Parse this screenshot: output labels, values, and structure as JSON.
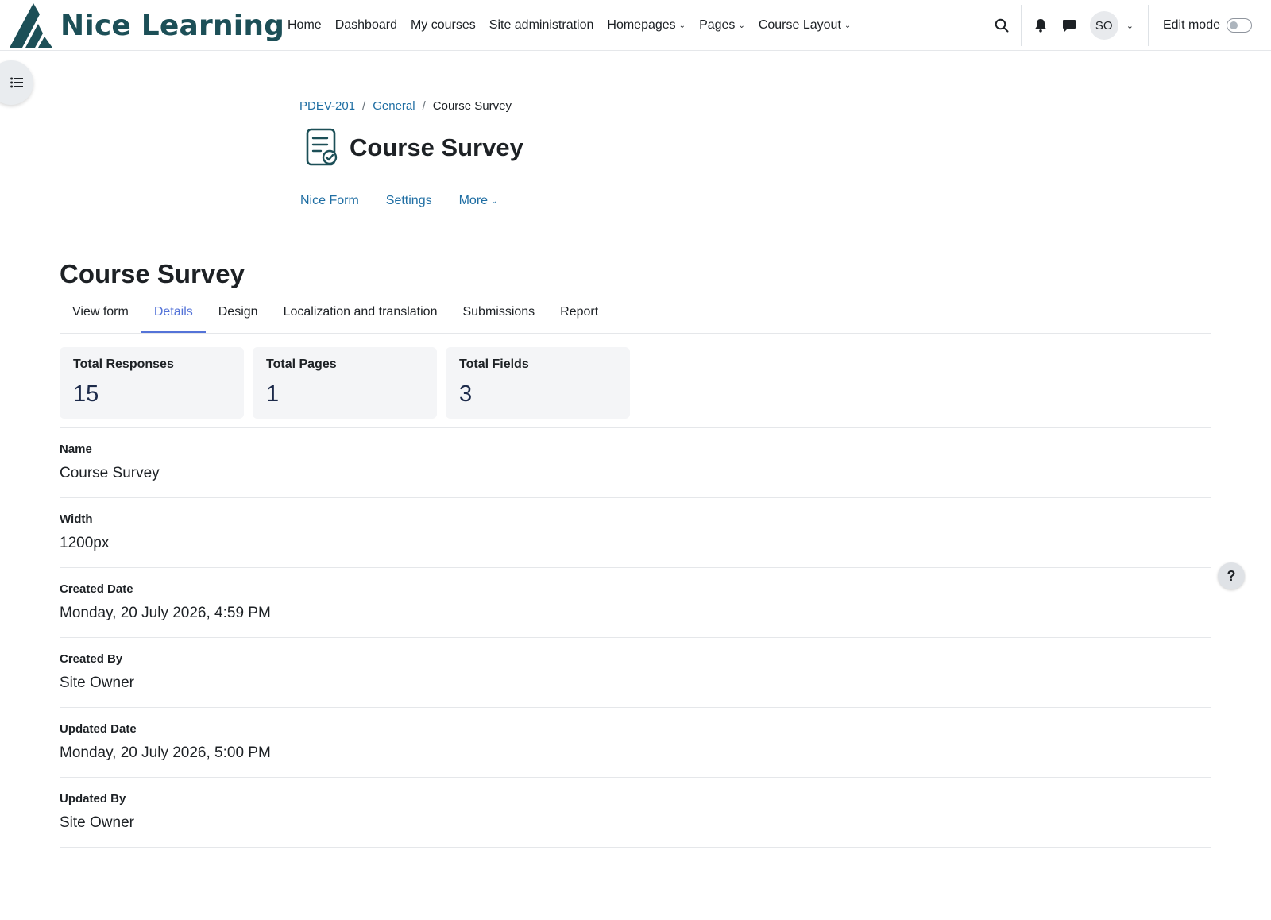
{
  "brand": {
    "name": "Nice Learning"
  },
  "nav": {
    "home": "Home",
    "dashboard": "Dashboard",
    "my_courses": "My courses",
    "site_admin": "Site administration",
    "homepages": "Homepages",
    "pages": "Pages",
    "course_layout": "Course Layout"
  },
  "user": {
    "initials": "SO"
  },
  "edit_mode": {
    "label": "Edit mode",
    "enabled": false
  },
  "breadcrumb": {
    "course": "PDEV-201",
    "section": "General",
    "current": "Course Survey"
  },
  "page": {
    "title": "Course Survey"
  },
  "secondary_nav": {
    "nice_form": "Nice Form",
    "settings": "Settings",
    "more": "More"
  },
  "content": {
    "title": "Course Survey"
  },
  "tabs": {
    "view_form": "View form",
    "details": "Details",
    "design": "Design",
    "localization": "Localization and translation",
    "submissions": "Submissions",
    "report": "Report",
    "active": "details"
  },
  "stats": [
    {
      "label": "Total Responses",
      "value": "15"
    },
    {
      "label": "Total Pages",
      "value": "1"
    },
    {
      "label": "Total Fields",
      "value": "3"
    }
  ],
  "details": [
    {
      "label": "Name",
      "value": "Course Survey"
    },
    {
      "label": "Width",
      "value": "1200px"
    },
    {
      "label": "Created Date",
      "value": "Monday, 20 July 2026, 4:59 PM"
    },
    {
      "label": "Created By",
      "value": "Site Owner"
    },
    {
      "label": "Updated Date",
      "value": "Monday, 20 July 2026, 5:00 PM"
    },
    {
      "label": "Updated By",
      "value": "Site Owner"
    }
  ],
  "help": {
    "label": "?"
  },
  "colors": {
    "brand": "#1c4f57",
    "link": "#1f6ea3",
    "active_tab": "#5473d8",
    "card_bg": "#f4f5f7"
  }
}
